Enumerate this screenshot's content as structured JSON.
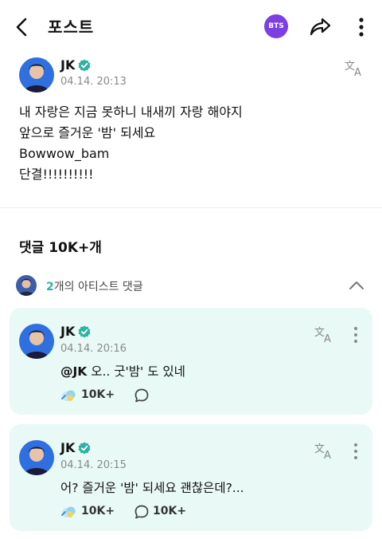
{
  "header": {
    "title": "포스트",
    "community_badge": "BTS"
  },
  "post": {
    "author": "JK",
    "timestamp": "04.14. 20:13",
    "lines": [
      "내 자랑은 지금 못하니 내새끼 자랑 해야지",
      "앞으로 즐거운 '밤' 되세요",
      "Bowwow_bam",
      "단결!!!!!!!!!!"
    ]
  },
  "comments": {
    "title": "댓글 10K+개",
    "artist_count": "2",
    "artist_label": "개의 아티스트 댓글",
    "items": [
      {
        "author": "JK",
        "timestamp": "04.14. 20:16",
        "mention": "@JK",
        "text": " 오.. 굿'밤' 도 있네",
        "likes": "10K+",
        "replies": ""
      },
      {
        "author": "JK",
        "timestamp": "04.14. 20:15",
        "mention": "",
        "text": "어? 즐거운 '밤' 되세요 괜찮은데?...",
        "likes": "10K+",
        "replies": "10K+"
      }
    ]
  },
  "colors": {
    "accent": "#2bb3a3",
    "card_bg": "#e8f9f6",
    "bts_badge": "#7b3fe4",
    "verified": "#2bb3a3"
  },
  "icons": [
    "back-arrow-icon",
    "share-icon",
    "more-vertical-icon",
    "verified-icon",
    "translate-icon",
    "chevron-up-icon",
    "like-icon",
    "comment-icon"
  ]
}
